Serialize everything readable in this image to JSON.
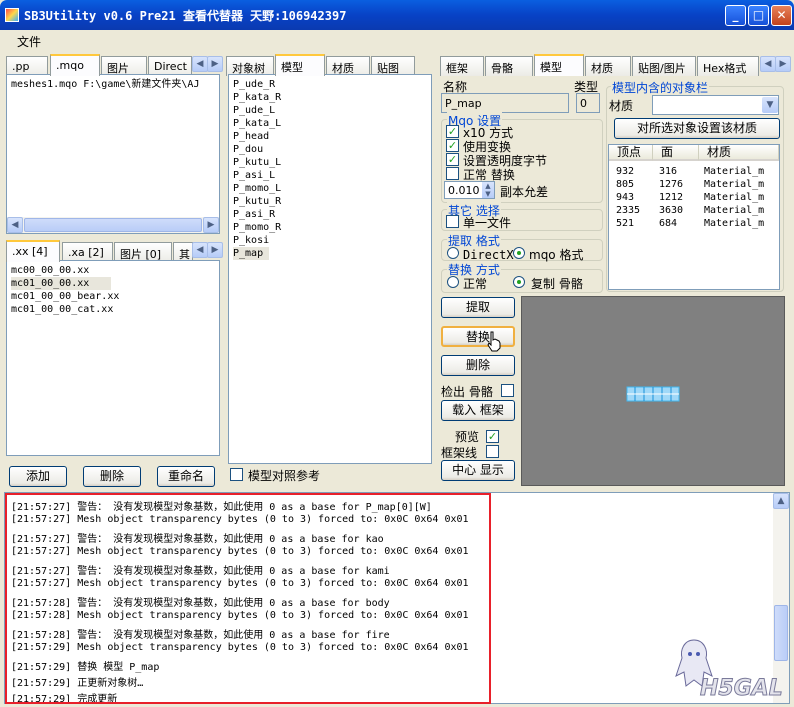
{
  "window": {
    "title": "SB3Utility v0.6 Pre21 查看代替器 天野:106942397"
  },
  "menu": {
    "file": "文件"
  },
  "left_top": {
    "tabs": [
      ".pp",
      ".mqo",
      "图片",
      "Direct"
    ],
    "items": [
      "meshes1.mqo  F:\\game\\新建文件夹\\AJ"
    ]
  },
  "left_bottom": {
    "tabs": [
      ".xx [4]",
      ".xa [2]",
      "图片 [0]",
      "其"
    ],
    "items": [
      "mc00_00_00.xx",
      "mc01_00_00.xx",
      "mc01_00_00_bear.xx",
      "mc01_00_00_cat.xx"
    ],
    "buttons": {
      "add": "添加",
      "delete": "删除",
      "rename": "重命名"
    }
  },
  "middle": {
    "tabs": [
      "对象树",
      "模型",
      "材质",
      "贴图"
    ],
    "items": [
      "P_ude_R",
      "P_kata_R",
      "P_ude_L",
      "P_kata_L",
      "P_head",
      "P_dou",
      "P_kutu_L",
      "P_asi_L",
      "P_momo_L",
      "P_kutu_R",
      "P_asi_R",
      "P_momo_R",
      "P_kosi",
      "P_map"
    ],
    "ref_checkbox": "模型对照参考"
  },
  "right": {
    "tabs": [
      "框架",
      "骨骼",
      "模型",
      "材质",
      "贴图/图片",
      "Hex格式"
    ],
    "name_label": "名称",
    "name_value": "P_map",
    "type_label": "类型",
    "type_value": "0",
    "mqo_group": "Mqo 设置",
    "opt_x10": "x10 方式",
    "opt_transform": "使用变换",
    "opt_transparency": "设置透明度字节",
    "opt_normal_replace": "正常 替换",
    "spin_value": "0.010",
    "spin_label": "副本允差",
    "other_group": "其它 选择",
    "opt_single_file": "单一文件",
    "extract_group": "提取 格式",
    "fmt_directx": "DirectX",
    "fmt_mqo": "mqo 格式",
    "replace_group": "替换 方式",
    "rep_normal": "正常",
    "rep_copy_bone": "复制 骨骼",
    "obj_group": "模型内含的对象栏",
    "material_label": "材质",
    "set_material_btn": "对所选对象设置该材质",
    "table_headers": [
      "顶点",
      "面",
      "材质"
    ],
    "table_rows": [
      [
        "932",
        "316",
        "Material_m"
      ],
      [
        "805",
        "1276",
        "Material_m"
      ],
      [
        "943",
        "1212",
        "Material_m"
      ],
      [
        "2335",
        "3630",
        "Material_m"
      ],
      [
        "521",
        "684",
        "Material_m"
      ]
    ],
    "btn_extract": "提取",
    "btn_replace": "替换",
    "btn_delete": "删除",
    "detect_bone": "检出 骨骼",
    "btn_load_frame": "载入 框架",
    "preview": "预览",
    "wireframe": "框架线",
    "btn_center": "中心 显示"
  },
  "log": [
    "[21:57:27] 警告： 没有发现模型对象基数，如此使用 0 as a base for P_map[0][W]",
    "[21:57:27] Mesh object transparency bytes (0 to 3) forced to: 0x0C 0x64 0x01",
    "[21:57:27] 警告： 没有发现模型对象基数，如此使用 0 as a base for kao",
    "[21:57:27] Mesh object transparency bytes (0 to 3) forced to: 0x0C 0x64 0x01",
    "[21:57:27] 警告： 没有发现模型对象基数，如此使用 0 as a base for kami",
    "[21:57:27] Mesh object transparency bytes (0 to 3) forced to: 0x0C 0x64 0x01",
    "[21:57:28] 警告： 没有发现模型对象基数，如此使用 0 as a base for body",
    "[21:57:28] Mesh object transparency bytes (0 to 3) forced to: 0x0C 0x64 0x01",
    "[21:57:28] 警告： 没有发现模型对象基数，如此使用 0 as a base for fire",
    "[21:57:29] Mesh object transparency bytes (0 to 3) forced to: 0x0C 0x64 0x01",
    "[21:57:29] 替换 模型 P_map",
    "[21:57:29] 正更新对象树…",
    "[21:57:29] 完成更新"
  ],
  "watermark": "H5GAL",
  "colors": {
    "highlight_box": "#e8202a",
    "preview_bg": "#808080",
    "mesh_color": "#40b8f0"
  }
}
